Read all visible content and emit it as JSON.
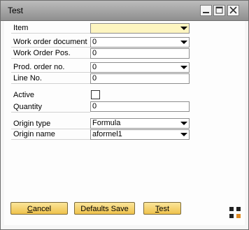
{
  "window": {
    "title": "Test"
  },
  "form": {
    "item": {
      "label": "Item",
      "value": ""
    },
    "work_order_document": {
      "label": "Work order document",
      "value": "0"
    },
    "work_order_pos": {
      "label": "Work Order Pos.",
      "value": "0"
    },
    "prod_order_no": {
      "label": "Prod. order no.",
      "value": "0"
    },
    "line_no": {
      "label": "Line No.",
      "value": "0"
    },
    "active": {
      "label": "Active",
      "checked": false
    },
    "quantity": {
      "label": "Quantity",
      "value": "0"
    },
    "origin_type": {
      "label": "Origin type",
      "value": "Formula"
    },
    "origin_name": {
      "label": "Origin name",
      "value": "aformel1"
    }
  },
  "buttons": {
    "cancel_prefix": "",
    "cancel_underlined": "C",
    "cancel_rest": "ancel",
    "defaults": "Defaults Save",
    "test_prefix": "",
    "test_underlined": "T",
    "test_rest": "est"
  },
  "icons": {
    "minimize": "minimize-icon",
    "maximize": "maximize-icon",
    "close": "close-icon",
    "corner": "resize-grip-icon"
  },
  "colors": {
    "button_top": "#fbe59a",
    "button_bottom": "#efc24c",
    "field_highlight": "#fdf5c0"
  }
}
